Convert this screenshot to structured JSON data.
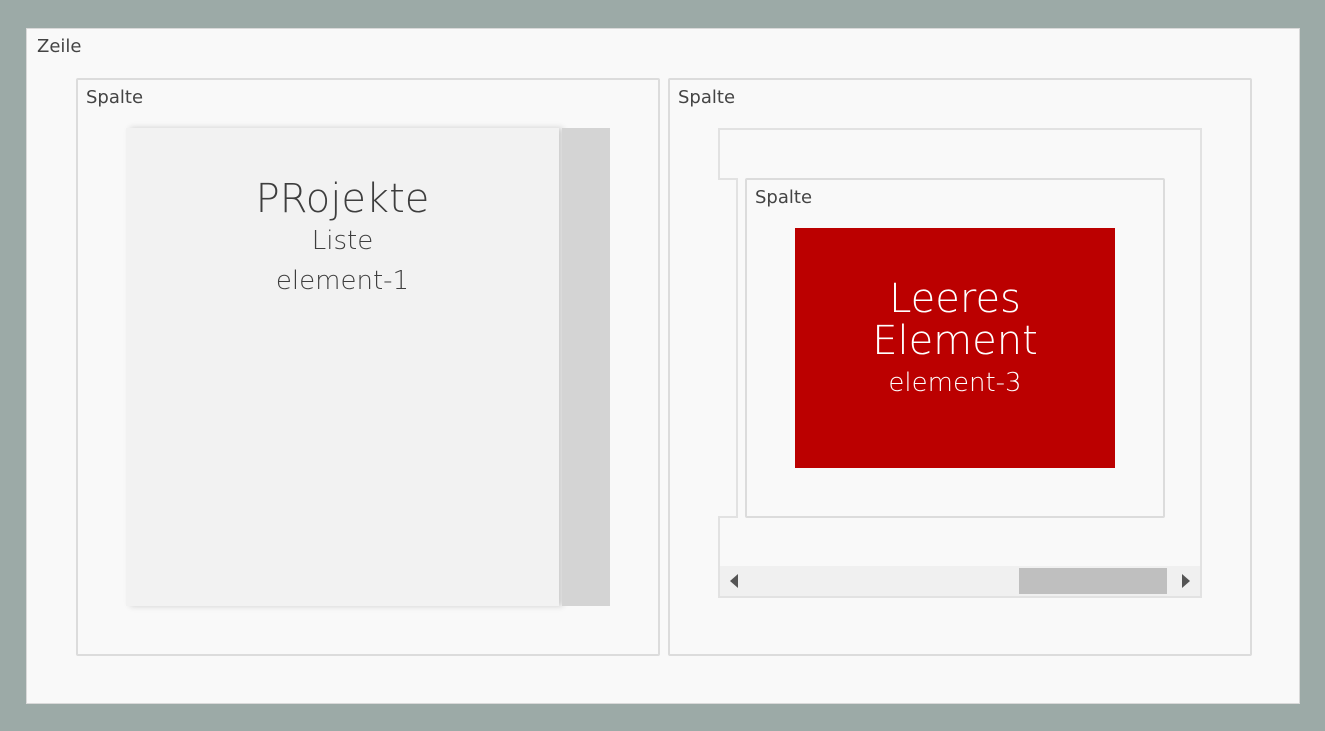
{
  "row": {
    "label": "Zeile"
  },
  "left_column": {
    "label": "Spalte",
    "card": {
      "title": "PRojekte",
      "type": "Liste",
      "id": "element-1"
    }
  },
  "right_column": {
    "label": "Spalte",
    "nested_column": {
      "label": "Spalte",
      "card": {
        "title_line1": "Leeres",
        "title_line2": "Element",
        "id": "element-3",
        "color": "#bb0000"
      }
    },
    "scrollbar": {
      "left_arrow": "scroll-left-arrow-icon",
      "right_arrow": "scroll-right-arrow-icon"
    }
  }
}
